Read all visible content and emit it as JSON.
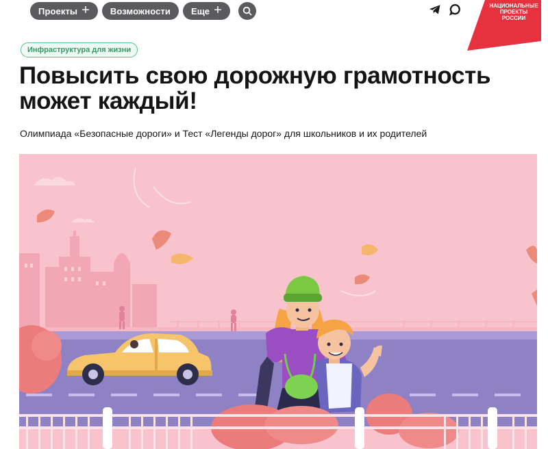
{
  "nav": {
    "projects_label": "Проекты",
    "projects_icon": "plus-icon",
    "features_label": "Возможности",
    "more_label": "Еще",
    "more_icon": "plus-icon",
    "search_icon": "search-icon"
  },
  "social": {
    "telegram_icon": "telegram-icon",
    "chat_icon": "chat-bubble-icon"
  },
  "logo": {
    "text_line1": "НАЦИОНАЛЬНЫЕ",
    "text_line2": "ПРОЕКТЫ",
    "text_line3": "РОССИИ",
    "color": "#e8313f"
  },
  "article": {
    "tag": "Инфраструктура для жизни",
    "title": "Повысить свою дорожную грамотность может каждый!",
    "subtitle": "Олимпиада «Безопасные дороги» и Тест «Легенды дорог» для школьников и их родителей"
  },
  "colors": {
    "nav_pill": "#5b5b5f",
    "tag_border": "#57c18c",
    "tag_text": "#2f9c68",
    "hero_sky": "#f8c3cd",
    "road": "#8f82c4"
  },
  "hero": {
    "description_icon": "illustration-autumn-road-family"
  }
}
